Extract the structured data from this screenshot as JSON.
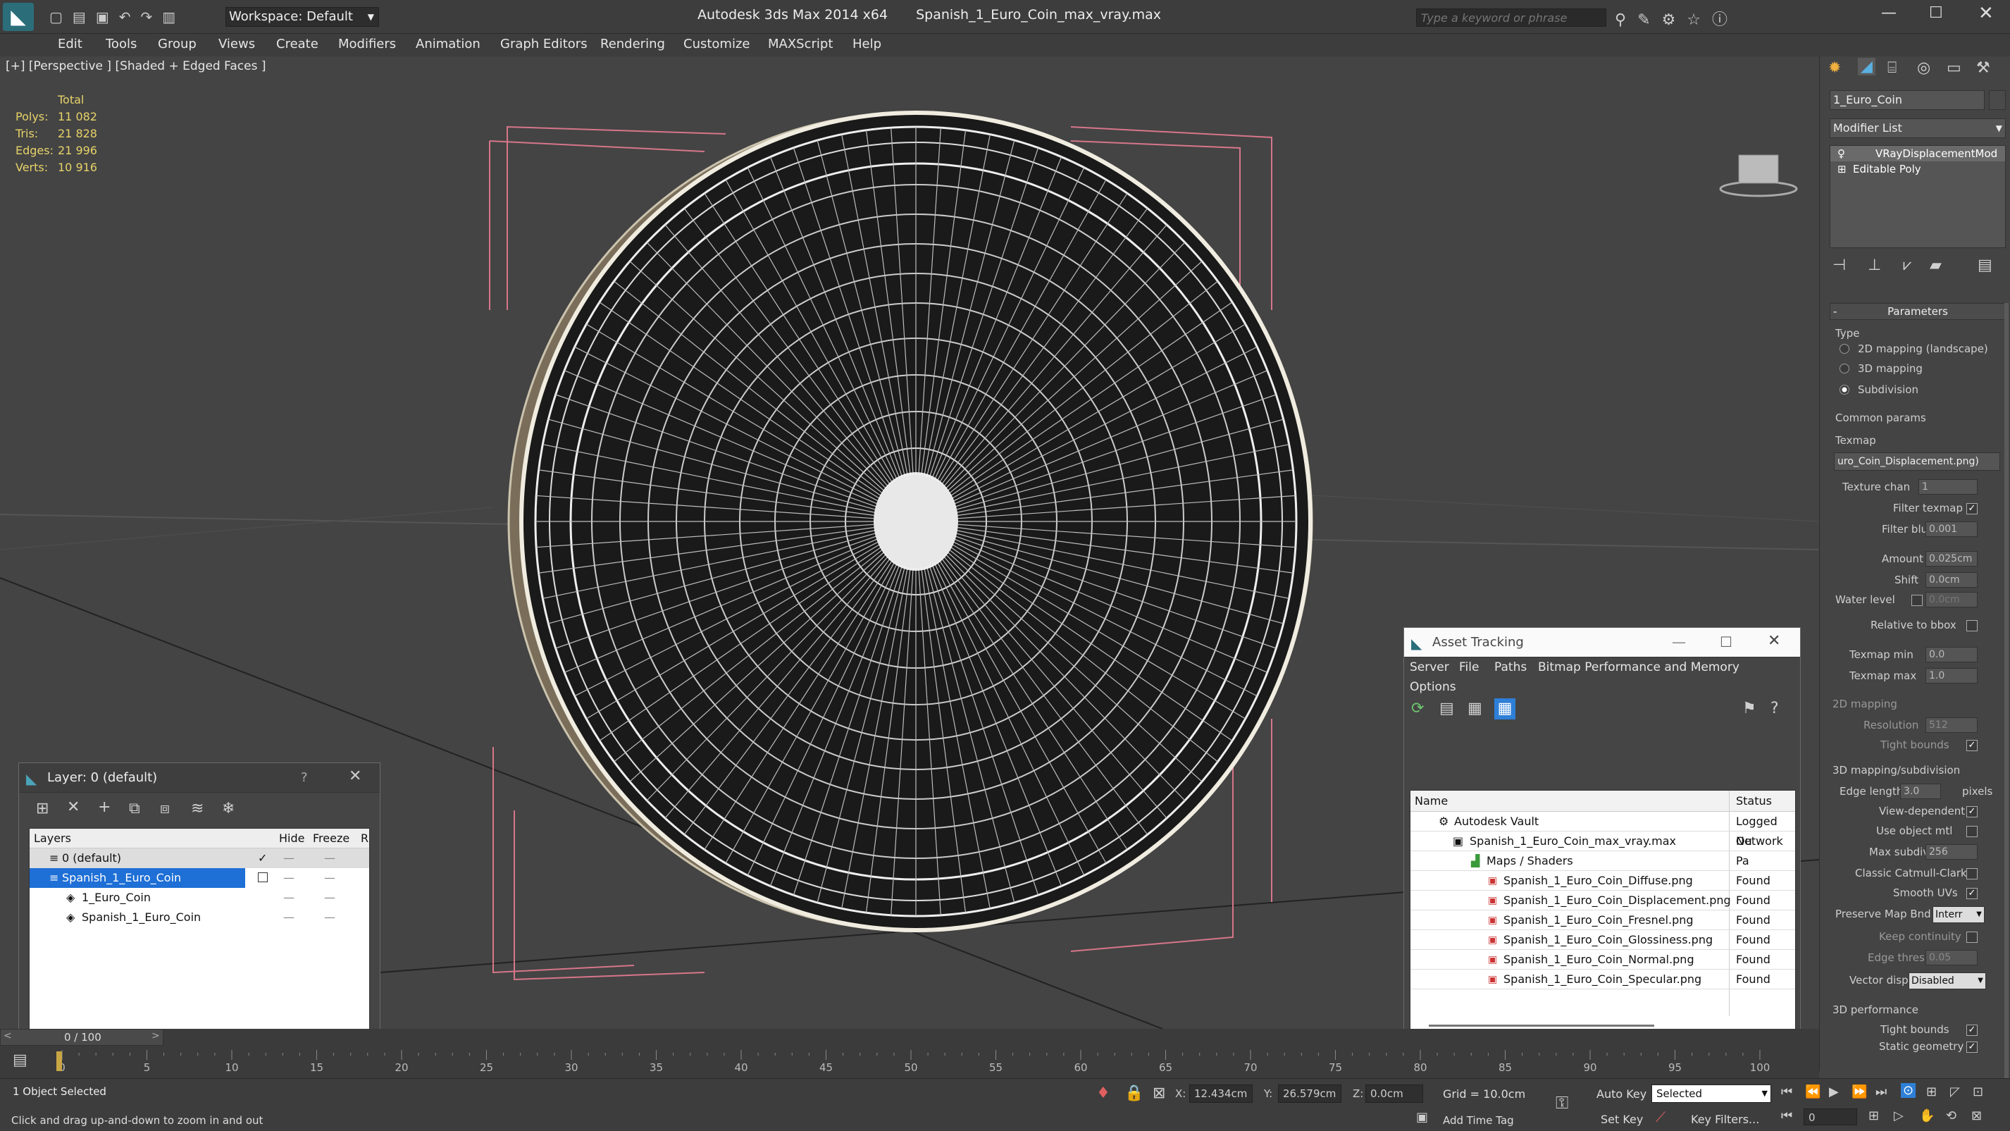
{
  "app": {
    "title": "Autodesk 3ds Max  2014 x64",
    "filename": "Spanish_1_Euro_Coin_max_vray.max",
    "workspace": "Workspace: Default",
    "search_placeholder": "Type a keyword or phrase"
  },
  "menu": [
    "Edit",
    "Tools",
    "Group",
    "Views",
    "Create",
    "Modifiers",
    "Animation",
    "Graph Editors",
    "Rendering",
    "Customize",
    "MAXScript",
    "Help"
  ],
  "viewport": {
    "label": "[+] [Perspective ] [Shaded + Edged Faces ]",
    "stats": {
      "total_label": "Total",
      "rows": [
        {
          "label": "Polys:",
          "value": "11 082"
        },
        {
          "label": "Tris:",
          "value": "21 828"
        },
        {
          "label": "Edges:",
          "value": "21 996"
        },
        {
          "label": "Verts:",
          "value": "10 916"
        }
      ]
    }
  },
  "layer_dialog": {
    "title": "Layer: 0 (default)",
    "help": "?",
    "columns": {
      "layers": "Layers",
      "hide": "Hide",
      "freeze": "Freeze",
      "r": "R"
    },
    "rows": [
      {
        "name": "0 (default)"
      },
      {
        "name": "Spanish_1_Euro_Coin"
      },
      {
        "name": "1_Euro_Coin"
      },
      {
        "name": "Spanish_1_Euro_Coin"
      }
    ]
  },
  "asset_tracking": {
    "title": "Asset Tracking",
    "menu": [
      "Server",
      "File",
      "Paths",
      "Bitmap Performance and Memory"
    ],
    "menu2": "Options",
    "columns": {
      "name": "Name",
      "status": "Status"
    },
    "rows": [
      {
        "name": "Autodesk Vault",
        "status": "Logged Ou"
      },
      {
        "name": "Spanish_1_Euro_Coin_max_vray.max",
        "status": "Network Pa"
      },
      {
        "name": "Maps / Shaders",
        "status": ""
      },
      {
        "name": "Spanish_1_Euro_Coin_Diffuse.png",
        "status": "Found"
      },
      {
        "name": "Spanish_1_Euro_Coin_Displacement.png",
        "status": "Found"
      },
      {
        "name": "Spanish_1_Euro_Coin_Fresnel.png",
        "status": "Found"
      },
      {
        "name": "Spanish_1_Euro_Coin_Glossiness.png",
        "status": "Found"
      },
      {
        "name": "Spanish_1_Euro_Coin_Normal.png",
        "status": "Found"
      },
      {
        "name": "Spanish_1_Euro_Coin_Specular.png",
        "status": "Found"
      }
    ]
  },
  "command_panel": {
    "object_name": "1_Euro_Coin",
    "modifier_list": "Modifier List",
    "stack": [
      "VRayDisplacementMod",
      "Editable Poly"
    ],
    "parameters": "Parameters",
    "type_label": "Type",
    "type_options": [
      "2D mapping (landscape)",
      "3D mapping",
      "Subdivision"
    ],
    "common_params": "Common params",
    "texmap": "Texmap",
    "texmap_value": "uro_Coin_Displacement.png)",
    "texture_chan": "Texture chan",
    "texture_chan_value": "1",
    "filter_texmap": "Filter texmap",
    "filter_blur": "Filter blur",
    "filter_blur_value": "0.001",
    "amount": "Amount",
    "amount_value": "0.025cm",
    "shift": "Shift",
    "shift_value": "0.0cm",
    "water_level": "Water level",
    "water_level_value": "0.0cm",
    "relative_bbox": "Relative to bbox",
    "texmap_min": "Texmap min",
    "texmap_min_value": "0.0",
    "texmap_max": "Texmap max",
    "texmap_max_value": "1.0",
    "mapping2d": "2D mapping",
    "resolution": "Resolution",
    "resolution_value": "512",
    "tight_bounds": "Tight bounds",
    "mapping3d": "3D mapping/subdivision",
    "edge_length": "Edge length",
    "edge_length_value": "3.0",
    "pixels": "pixels",
    "view_dependent": "View-dependent",
    "use_object_mtl": "Use object mtl",
    "max_subdivs": "Max subdivs",
    "max_subdivs_value": "256",
    "classic_catmull": "Classic Catmull-Clark",
    "smooth_uvs": "Smooth UVs",
    "preserve_map": "Preserve Map Bnd",
    "preserve_map_value": "Interr",
    "keep_continuity": "Keep continuity",
    "edge_thresh": "Edge thresh",
    "edge_thresh_value": "0.05",
    "vector_displ": "Vector displ",
    "vector_displ_value": "Disabled",
    "perf3d": "3D performance",
    "tight_bounds2": "Tight bounds",
    "static_geometry": "Static geometry"
  },
  "timeline": {
    "frame": "0 / 100",
    "ticks": [
      "0",
      "5",
      "10",
      "15",
      "20",
      "25",
      "30",
      "35",
      "40",
      "45",
      "50",
      "55",
      "60",
      "65",
      "70",
      "75",
      "80",
      "85",
      "90",
      "95",
      "100"
    ]
  },
  "status": {
    "selected": "1 Object Selected",
    "hint": "Click and drag up-and-down to zoom in and out",
    "x_label": "X:",
    "x": "12.434cm",
    "y_label": "Y:",
    "y": "26.579cm",
    "z_label": "Z:",
    "z": "0.0cm",
    "grid": "Grid = 10.0cm",
    "auto_key": "Auto Key",
    "selected_dropdown": "Selected",
    "set_key": "Set Key",
    "key_filters": "Key Filters...",
    "add_time_tag": "Add Time Tag",
    "frame_field": "0"
  }
}
